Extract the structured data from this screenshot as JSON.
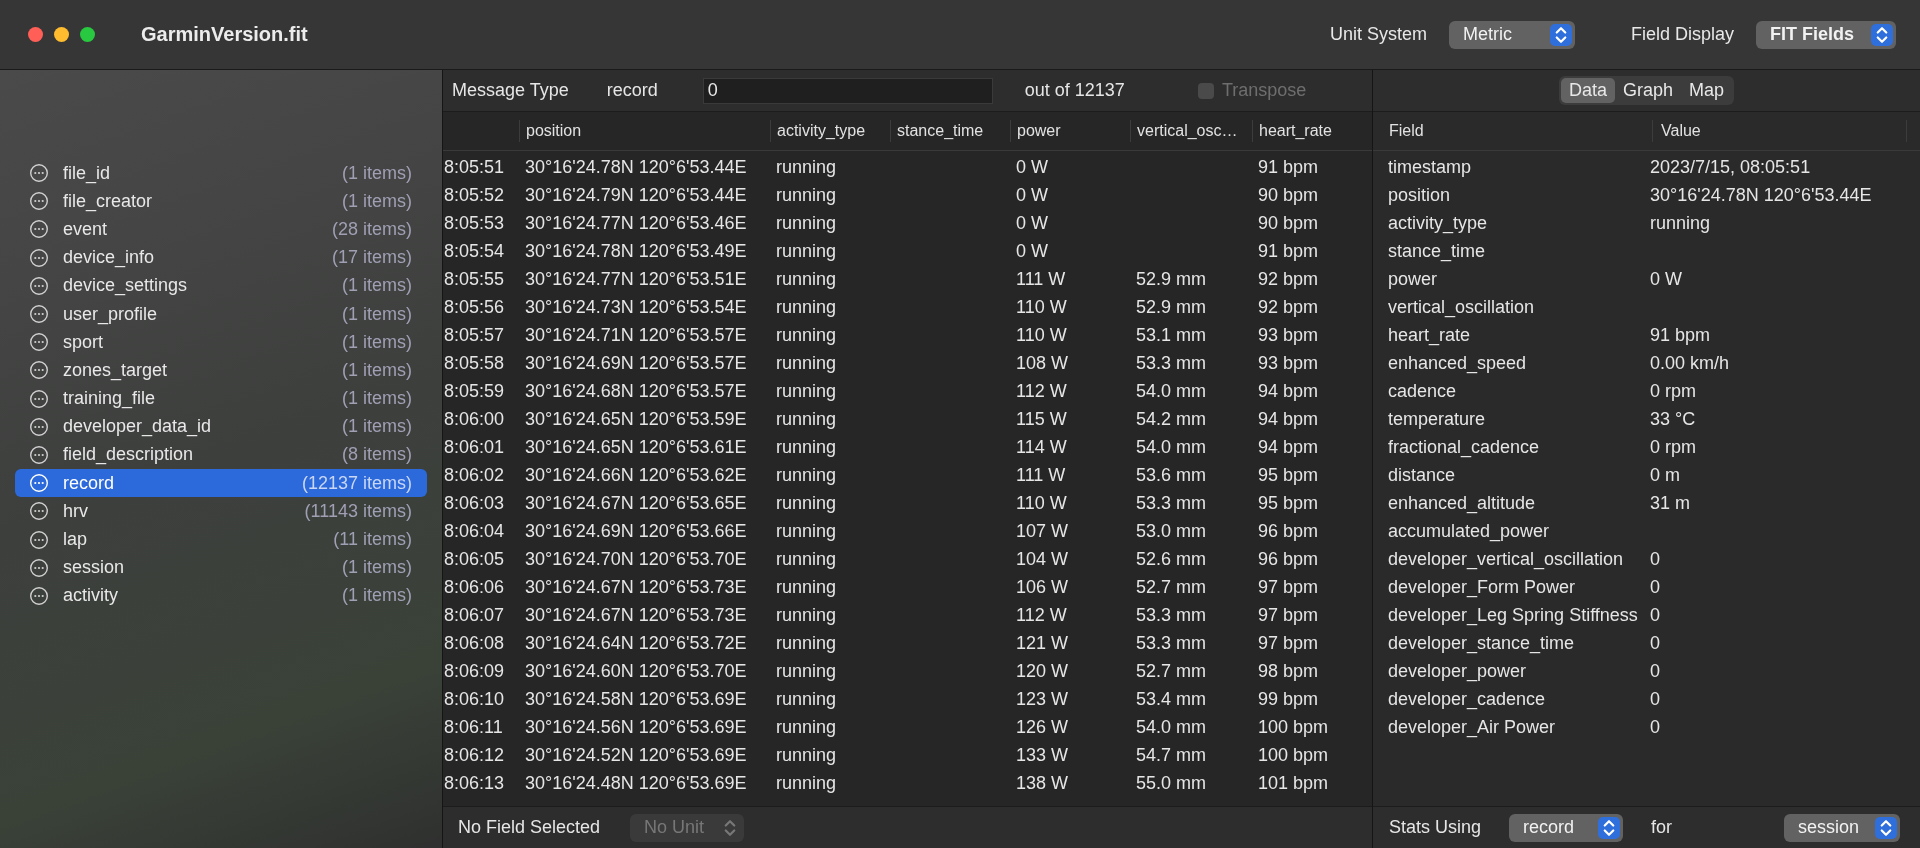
{
  "window": {
    "title": "GarminVersion.fit"
  },
  "toolbar": {
    "unit_system": {
      "label": "Unit System",
      "value": "Metric"
    },
    "field_display": {
      "label": "Field Display",
      "value": "FIT Fields"
    }
  },
  "sidebar": {
    "items": [
      {
        "name": "file_id",
        "count": "(1 items)",
        "selected": false
      },
      {
        "name": "file_creator",
        "count": "(1 items)",
        "selected": false
      },
      {
        "name": "event",
        "count": "(28 items)",
        "selected": false
      },
      {
        "name": "device_info",
        "count": "(17 items)",
        "selected": false
      },
      {
        "name": "device_settings",
        "count": "(1 items)",
        "selected": false
      },
      {
        "name": "user_profile",
        "count": "(1 items)",
        "selected": false
      },
      {
        "name": "sport",
        "count": "(1 items)",
        "selected": false
      },
      {
        "name": "zones_target",
        "count": "(1 items)",
        "selected": false
      },
      {
        "name": "training_file",
        "count": "(1 items)",
        "selected": false
      },
      {
        "name": "developer_data_id",
        "count": "(1 items)",
        "selected": false
      },
      {
        "name": "field_description",
        "count": "(8 items)",
        "selected": false
      },
      {
        "name": "record",
        "count": "(12137 items)",
        "selected": true
      },
      {
        "name": "hrv",
        "count": "(11143 items)",
        "selected": false
      },
      {
        "name": "lap",
        "count": "(11 items)",
        "selected": false
      },
      {
        "name": "session",
        "count": "(1 items)",
        "selected": false
      },
      {
        "name": "activity",
        "count": "(1 items)",
        "selected": false
      }
    ]
  },
  "message_bar": {
    "label": "Message Type",
    "type": "record",
    "index_value": "0",
    "total": "out of 12137",
    "transpose": {
      "label": "Transpose",
      "checked": false,
      "disabled": true
    }
  },
  "table": {
    "columns": [
      "position",
      "activity_type",
      "stance_time",
      "power",
      "vertical_osc…",
      "heart_rate"
    ],
    "rows": [
      {
        "time": "8:05:51",
        "cells": [
          "30°16'24.78N 120°6'53.44E",
          "running",
          null,
          "0 W",
          null,
          "91 bpm"
        ]
      },
      {
        "time": "8:05:52",
        "cells": [
          "30°16'24.79N 120°6'53.44E",
          "running",
          null,
          "0 W",
          null,
          "90 bpm"
        ]
      },
      {
        "time": "8:05:53",
        "cells": [
          "30°16'24.77N 120°6'53.46E",
          "running",
          null,
          "0 W",
          null,
          "90 bpm"
        ]
      },
      {
        "time": "8:05:54",
        "cells": [
          "30°16'24.78N 120°6'53.49E",
          "running",
          null,
          "0 W",
          null,
          "91 bpm"
        ]
      },
      {
        "time": "8:05:55",
        "cells": [
          "30°16'24.77N 120°6'53.51E",
          "running",
          null,
          "111 W",
          "52.9 mm",
          "92 bpm"
        ]
      },
      {
        "time": "8:05:56",
        "cells": [
          "30°16'24.73N 120°6'53.54E",
          "running",
          null,
          "110 W",
          "52.9 mm",
          "92 bpm"
        ]
      },
      {
        "time": "8:05:57",
        "cells": [
          "30°16'24.71N 120°6'53.57E",
          "running",
          null,
          "110 W",
          "53.1 mm",
          "93 bpm"
        ]
      },
      {
        "time": "8:05:58",
        "cells": [
          "30°16'24.69N 120°6'53.57E",
          "running",
          null,
          "108 W",
          "53.3 mm",
          "93 bpm"
        ]
      },
      {
        "time": "8:05:59",
        "cells": [
          "30°16'24.68N 120°6'53.57E",
          "running",
          null,
          "112 W",
          "54.0 mm",
          "94 bpm"
        ]
      },
      {
        "time": "8:06:00",
        "cells": [
          "30°16'24.65N 120°6'53.59E",
          "running",
          null,
          "115 W",
          "54.2 mm",
          "94 bpm"
        ]
      },
      {
        "time": "8:06:01",
        "cells": [
          "30°16'24.65N 120°6'53.61E",
          "running",
          null,
          "114 W",
          "54.0 mm",
          "94 bpm"
        ]
      },
      {
        "time": "8:06:02",
        "cells": [
          "30°16'24.66N 120°6'53.62E",
          "running",
          null,
          "111 W",
          "53.6 mm",
          "95 bpm"
        ]
      },
      {
        "time": "8:06:03",
        "cells": [
          "30°16'24.67N 120°6'53.65E",
          "running",
          null,
          "110 W",
          "53.3 mm",
          "95 bpm"
        ]
      },
      {
        "time": "8:06:04",
        "cells": [
          "30°16'24.69N 120°6'53.66E",
          "running",
          null,
          "107 W",
          "53.0 mm",
          "96 bpm"
        ]
      },
      {
        "time": "8:06:05",
        "cells": [
          "30°16'24.70N 120°6'53.70E",
          "running",
          null,
          "104 W",
          "52.6 mm",
          "96 bpm"
        ]
      },
      {
        "time": "8:06:06",
        "cells": [
          "30°16'24.67N 120°6'53.73E",
          "running",
          null,
          "106 W",
          "52.7 mm",
          "97 bpm"
        ]
      },
      {
        "time": "8:06:07",
        "cells": [
          "30°16'24.67N 120°6'53.73E",
          "running",
          null,
          "112 W",
          "53.3 mm",
          "97 bpm"
        ]
      },
      {
        "time": "8:06:08",
        "cells": [
          "30°16'24.64N 120°6'53.72E",
          "running",
          null,
          "121 W",
          "53.3 mm",
          "97 bpm"
        ]
      },
      {
        "time": "8:06:09",
        "cells": [
          "30°16'24.60N 120°6'53.70E",
          "running",
          null,
          "120 W",
          "52.7 mm",
          "98 bpm"
        ]
      },
      {
        "time": "8:06:10",
        "cells": [
          "30°16'24.58N 120°6'53.69E",
          "running",
          null,
          "123 W",
          "53.4 mm",
          "99 bpm"
        ]
      },
      {
        "time": "8:06:11",
        "cells": [
          "30°16'24.56N 120°6'53.69E",
          "running",
          null,
          "126 W",
          "54.0 mm",
          "100 bpm"
        ]
      },
      {
        "time": "8:06:12",
        "cells": [
          "30°16'24.52N 120°6'53.69E",
          "running",
          null,
          "133 W",
          "54.7 mm",
          "100 bpm"
        ]
      },
      {
        "time": "8:06:13",
        "cells": [
          "30°16'24.48N 120°6'53.69E",
          "running",
          null,
          "138 W",
          "55.0 mm",
          "101 bpm"
        ]
      }
    ]
  },
  "detail": {
    "tabs": [
      {
        "label": "Data",
        "selected": true
      },
      {
        "label": "Graph",
        "selected": false
      },
      {
        "label": "Map",
        "selected": false
      }
    ],
    "columns": [
      "Field",
      "Value"
    ],
    "fields": [
      {
        "name": "timestamp",
        "value": "2023/7/15, 08:05:51"
      },
      {
        "name": "position",
        "value": "30°16'24.78N 120°6'53.44E"
      },
      {
        "name": "activity_type",
        "value": "running"
      },
      {
        "name": "stance_time"
      },
      {
        "name": "power",
        "value": "0 W"
      },
      {
        "name": "vertical_oscillation"
      },
      {
        "name": "heart_rate",
        "value": "91 bpm"
      },
      {
        "name": "enhanced_speed",
        "value": "0.00 km/h"
      },
      {
        "name": "cadence",
        "value": "0 rpm"
      },
      {
        "name": "temperature",
        "value": "33 °C"
      },
      {
        "name": "fractional_cadence",
        "value": "0 rpm"
      },
      {
        "name": "distance",
        "value": "0 m"
      },
      {
        "name": "enhanced_altitude",
        "value": "31 m"
      },
      {
        "name": "accumulated_power"
      },
      {
        "name": "developer_vertical_oscillation",
        "value": "0"
      },
      {
        "name": "developer_Form Power",
        "value": "0"
      },
      {
        "name": "developer_Leg Spring Stiffness",
        "value": "0"
      },
      {
        "name": "developer_stance_time",
        "value": "0"
      },
      {
        "name": "developer_power",
        "value": "0"
      },
      {
        "name": "developer_cadence",
        "value": "0"
      },
      {
        "name": "developer_Air Power",
        "value": "0"
      }
    ]
  },
  "bottom_bar": {
    "field_status": "No Field Selected",
    "unit_popup": {
      "value": "No Unit",
      "disabled": true
    },
    "stats_label": "Stats Using",
    "stats_source": "record",
    "for_label": "for",
    "stats_scope": "session"
  }
}
